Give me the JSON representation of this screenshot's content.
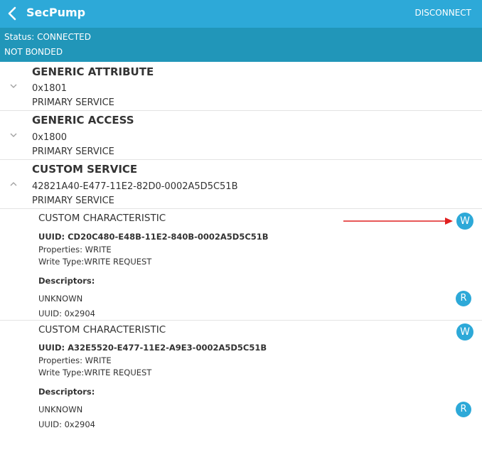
{
  "app": {
    "title": "SecPump",
    "disconnect_label": "DISCONNECT"
  },
  "status": {
    "connection": "Status: CONNECTED",
    "bonding": "NOT BONDED"
  },
  "services": [
    {
      "name": "GENERIC ATTRIBUTE",
      "uuid": "0x1801",
      "type": "PRIMARY SERVICE",
      "expanded": false
    },
    {
      "name": "GENERIC ACCESS",
      "uuid": "0x1800",
      "type": "PRIMARY SERVICE",
      "expanded": false
    },
    {
      "name": "CUSTOM SERVICE",
      "uuid": "42821A40-E477-11E2-82D0-0002A5D5C51B",
      "type": "PRIMARY SERVICE",
      "expanded": true
    }
  ],
  "characteristics": [
    {
      "name": "CUSTOM CHARACTERISTIC",
      "uuid": "UUID: CD20C480-E48B-11E2-840B-0002A5D5C51B",
      "properties": "Properties: WRITE",
      "write_type": "Write Type:WRITE REQUEST",
      "write_button": "W",
      "descriptors_label": "Descriptors:",
      "descriptor_name": "UNKNOWN",
      "descriptor_uuid": "UUID: 0x2904",
      "read_button": "R"
    },
    {
      "name": "CUSTOM CHARACTERISTIC",
      "uuid": "UUID: A32E5520-E477-11E2-A9E3-0002A5D5C51B",
      "properties": "Properties: WRITE",
      "write_type": "Write Type:WRITE REQUEST",
      "write_button": "W",
      "descriptors_label": "Descriptors:",
      "descriptor_name": "UNKNOWN",
      "descriptor_uuid": "UUID: 0x2904",
      "read_button": "R"
    }
  ],
  "colors": {
    "appbar": "#2da9d8",
    "statusbar": "#2196b9",
    "annotation_arrow": "#e02020"
  },
  "icons": {
    "back": "chevron-left-icon",
    "collapsed": "chevron-down-icon",
    "expanded": "chevron-up-icon"
  }
}
